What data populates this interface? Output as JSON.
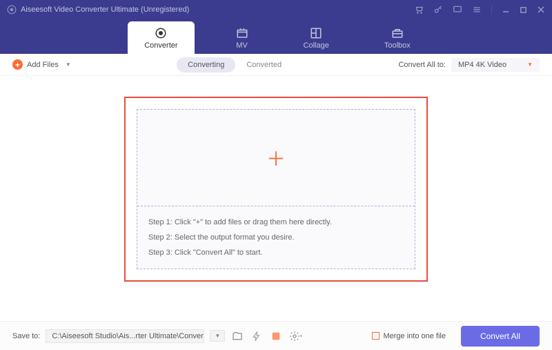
{
  "titlebar": {
    "title": "Aiseesoft Video Converter Ultimate (Unregistered)"
  },
  "tabs": {
    "converter": "Converter",
    "mv": "MV",
    "collage": "Collage",
    "toolbox": "Toolbox"
  },
  "toolbar": {
    "add_files": "Add Files",
    "converting": "Converting",
    "converted": "Converted",
    "convert_all_to": "Convert All to:",
    "format": "MP4 4K Video"
  },
  "steps": {
    "s1": "Step 1: Click \"+\" to add files or drag them here directly.",
    "s2": "Step 2: Select the output format you desire.",
    "s3": "Step 3: Click \"Convert All\" to start."
  },
  "footer": {
    "save_to": "Save to:",
    "path": "C:\\Aiseesoft Studio\\Ais...rter Ultimate\\Converted",
    "merge": "Merge into one file",
    "convert_all": "Convert All"
  }
}
